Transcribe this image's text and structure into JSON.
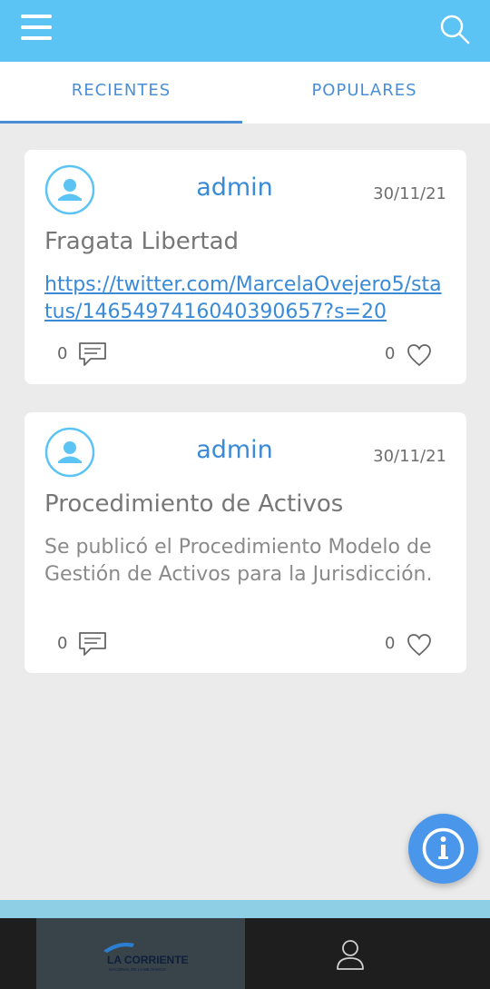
{
  "tabs": {
    "recent": "RECIENTES",
    "popular": "POPULARES"
  },
  "posts": [
    {
      "author": "admin",
      "date": "30/11/21",
      "title": "Fragata Libertad",
      "link": "https://twitter.com/MarcelaOvejero5/status/1465497416040390657?s=20",
      "comments": "0",
      "likes": "0"
    },
    {
      "author": "admin",
      "date": "30/11/21",
      "title": "Procedimiento de Activos",
      "body": "Se publicó el Procedimiento Modelo de Gestión de Activos para la Jurisdicción.",
      "comments": "0",
      "likes": "0"
    }
  ],
  "logo": {
    "name": "LA CORRIENTE",
    "subtitle": "NACIONAL DE LA MILITANCIA"
  },
  "colors": {
    "appbar": "#5bc4f4",
    "accent": "#4a8fd6",
    "fab": "#4a96ea"
  },
  "icons": [
    "menu-icon",
    "search-icon",
    "user-avatar-icon",
    "comment-icon",
    "heart-icon",
    "info-icon",
    "profile-icon"
  ]
}
